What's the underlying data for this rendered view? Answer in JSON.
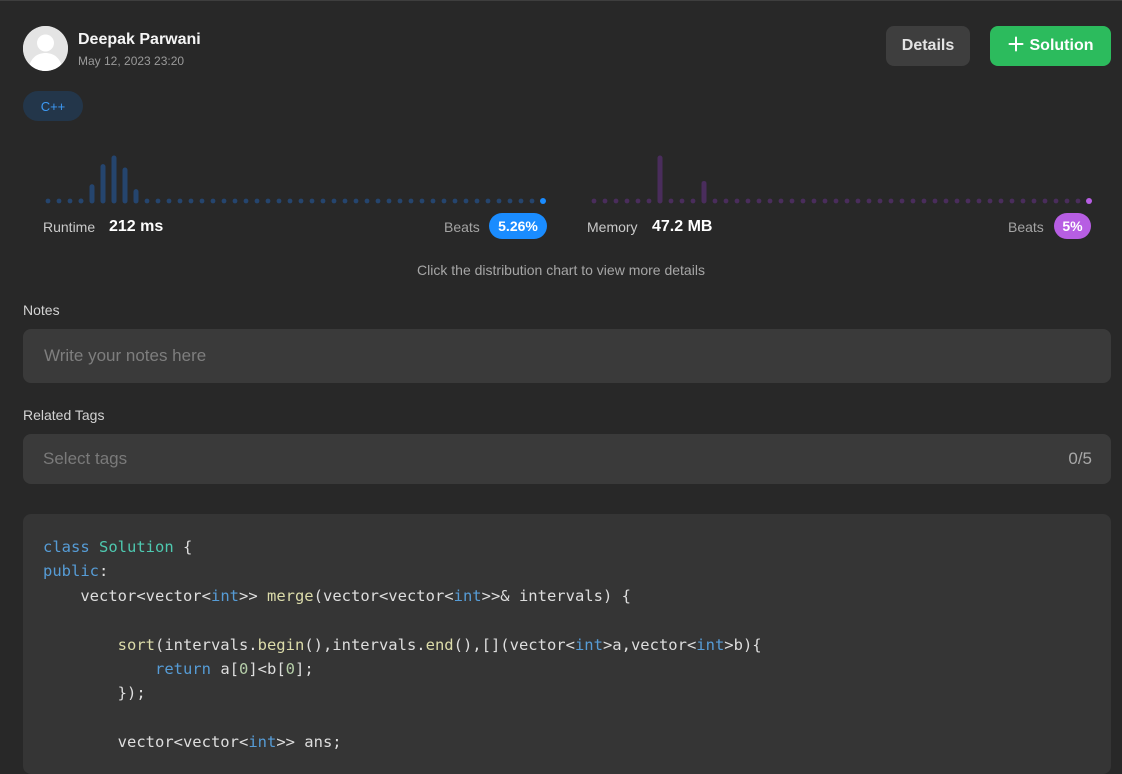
{
  "header": {
    "user_name": "Deepak Parwani",
    "timestamp": "May 12, 2023 23:20",
    "avatar_icon": "user-avatar-icon",
    "details_label": "Details",
    "solution_label": "Solution",
    "solution_icon": "plus-icon"
  },
  "language_tag": "C++",
  "runtime": {
    "label": "Runtime",
    "value": "212 ms",
    "beats_label": "Beats",
    "beats_value": "5.26%",
    "accent": "#1a8cff",
    "bar_color": "#25456e",
    "distribution": [
      0,
      0,
      0,
      0.1,
      0.4,
      0.82,
      1,
      0.75,
      0.3,
      0,
      0,
      0,
      0,
      0,
      0,
      0,
      0,
      0,
      0,
      0,
      0,
      0,
      0,
      0,
      0,
      0,
      0,
      0,
      0,
      0,
      0,
      0,
      0,
      0,
      0,
      0,
      0,
      0,
      0,
      0,
      0,
      0,
      0,
      0,
      0,
      0
    ],
    "highlight_index": 45
  },
  "memory": {
    "label": "Memory",
    "value": "47.2 MB",
    "beats_label": "Beats",
    "beats_value": "5%",
    "accent": "#b75ee3",
    "bar_color": "#4a2d5c",
    "distribution": [
      0,
      0,
      0,
      0,
      0,
      0,
      1,
      0,
      0,
      0,
      0.47,
      0,
      0,
      0,
      0,
      0,
      0,
      0,
      0,
      0,
      0,
      0,
      0,
      0,
      0,
      0,
      0,
      0,
      0,
      0,
      0,
      0,
      0,
      0,
      0,
      0,
      0,
      0,
      0,
      0,
      0,
      0,
      0,
      0,
      0,
      0
    ],
    "highlight_index": 45
  },
  "hint": "Click the distribution chart to view more details",
  "notes": {
    "label": "Notes",
    "placeholder": "Write your notes here"
  },
  "tags": {
    "label": "Related Tags",
    "placeholder": "Select tags",
    "count": "0/5"
  },
  "code_lines": [
    [
      [
        "kw",
        "class"
      ],
      [
        "",
        "",
        " "
      ],
      [
        "ty",
        "Solution"
      ],
      [
        "",
        " {"
      ]
    ],
    [
      [
        "kw",
        "public"
      ],
      [
        "",
        ":"
      ]
    ],
    [
      [
        "",
        "    vector<vector<"
      ],
      [
        "kw",
        "int"
      ],
      [
        "",
        ">> "
      ],
      [
        "fn",
        "merge"
      ],
      [
        "",
        "(vector<vector<"
      ],
      [
        "kw",
        "int"
      ],
      [
        "",
        ">>& intervals) {"
      ]
    ],
    [
      [
        "",
        ""
      ]
    ],
    [
      [
        "",
        "        "
      ],
      [
        "fn",
        "sort"
      ],
      [
        "",
        "(intervals."
      ],
      [
        "fn",
        "begin"
      ],
      [
        "",
        "(),intervals."
      ],
      [
        "fn",
        "end"
      ],
      [
        "",
        "(),[](vector<"
      ],
      [
        "kw",
        "int"
      ],
      [
        "",
        ">a,vector<"
      ],
      [
        "kw",
        "int"
      ],
      [
        "",
        ">b){"
      ]
    ],
    [
      [
        "",
        "            "
      ],
      [
        "kw",
        "return"
      ],
      [
        "",
        " a["
      ],
      [
        "nm",
        "0"
      ],
      [
        "",
        "]<b["
      ],
      [
        "nm",
        "0"
      ],
      [
        "",
        "];"
      ]
    ],
    [
      [
        "",
        "        });"
      ]
    ],
    [
      [
        "",
        ""
      ]
    ],
    [
      [
        "",
        "        vector<vector<"
      ],
      [
        "kw",
        "int"
      ],
      [
        "",
        ">> ans;"
      ]
    ]
  ]
}
